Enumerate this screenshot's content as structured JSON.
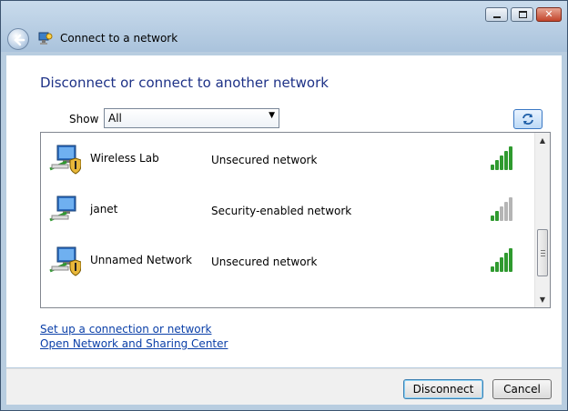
{
  "window": {
    "title": "Connect to a network",
    "controls": {
      "minimize": "minimize",
      "maximize": "maximize",
      "close": "close"
    }
  },
  "heading": "Disconnect or connect to another network",
  "filter": {
    "label": "Show",
    "selected": "All"
  },
  "networks": [
    {
      "name": "Wireless Lab",
      "security": "Unsecured network",
      "signal_bars": 5,
      "shield": true
    },
    {
      "name": "janet",
      "security": "Security-enabled network",
      "signal_bars": 2,
      "shield": false
    },
    {
      "name": "Unnamed Network",
      "security": "Unsecured network",
      "signal_bars": 5,
      "shield": true
    }
  ],
  "links": {
    "setup": "Set up a connection or network",
    "sharing_center": "Open Network and Sharing Center"
  },
  "buttons": {
    "disconnect": "Disconnect",
    "cancel": "Cancel"
  },
  "colors": {
    "heading": "#1e3287",
    "link": "#0a3fa8",
    "signal_on": "#2f9a2f",
    "signal_off": "#b5b5b5"
  },
  "icons": {
    "back": "back-arrow-icon",
    "refresh": "refresh-icon",
    "network": "network-computer-icon"
  }
}
